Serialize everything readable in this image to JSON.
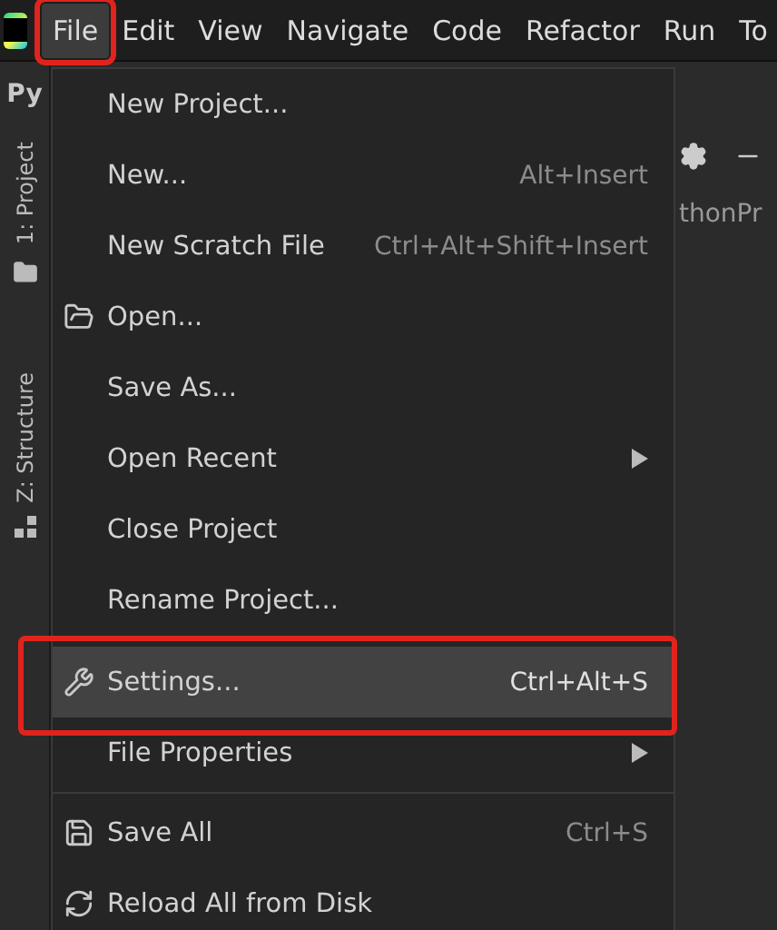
{
  "menu_bar": [
    {
      "label": "File",
      "selected": true,
      "annotated": true
    },
    {
      "label": "Edit",
      "selected": false,
      "annotated": false
    },
    {
      "label": "View",
      "selected": false,
      "annotated": false
    },
    {
      "label": "Navigate",
      "selected": false,
      "annotated": false
    },
    {
      "label": "Code",
      "selected": false,
      "annotated": false
    },
    {
      "label": "Refactor",
      "selected": false,
      "annotated": false
    },
    {
      "label": "Run",
      "selected": false,
      "annotated": false
    },
    {
      "label": "To",
      "selected": false,
      "annotated": false
    }
  ],
  "project_label": "Py",
  "tool_tabs": [
    "1: Project",
    "Z: Structure"
  ],
  "editor_tab_text": "thonPr",
  "file_menu": {
    "sections": [
      [
        {
          "label": "New Project...",
          "submenu": false,
          "selected": false,
          "annotated": false
        },
        {
          "label": "New...",
          "shortcut": "Alt+Insert",
          "submenu": false,
          "selected": false,
          "annotated": false
        },
        {
          "label": "New Scratch File",
          "shortcut": "Ctrl+Alt+Shift+Insert",
          "submenu": false,
          "selected": false,
          "annotated": false
        },
        {
          "label": "Open...",
          "submenu": false,
          "selected": false,
          "annotated": false
        },
        {
          "label": "Save As...",
          "submenu": false,
          "selected": false,
          "annotated": false
        },
        {
          "label": "Open Recent",
          "submenu": true,
          "selected": false,
          "annotated": false
        },
        {
          "label": "Close Project",
          "submenu": false,
          "selected": false,
          "annotated": false
        },
        {
          "label": "Rename Project...",
          "submenu": false,
          "selected": false,
          "annotated": false
        },
        {
          "label": "Settings...",
          "shortcut": "Ctrl+Alt+S",
          "submenu": false,
          "selected": true,
          "annotated": true
        },
        {
          "label": "File Properties",
          "submenu": true,
          "selected": false,
          "annotated": false
        }
      ],
      [
        {
          "label": "Save All",
          "shortcut": "Ctrl+S",
          "submenu": false,
          "selected": false,
          "annotated": false
        },
        {
          "label": "Reload All from Disk",
          "submenu": false,
          "selected": false,
          "annotated": false
        }
      ]
    ]
  }
}
